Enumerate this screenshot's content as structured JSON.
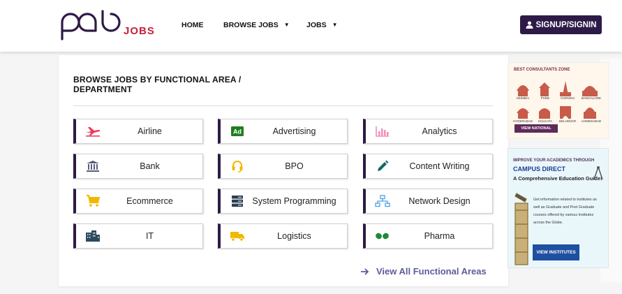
{
  "header": {
    "logo_main": "pab",
    "logo_sub": "JOBS",
    "nav": [
      {
        "label": "HOME",
        "dropdown": false
      },
      {
        "label": "BROWSE JOBS",
        "dropdown": true
      },
      {
        "label": "JOBS",
        "dropdown": true
      }
    ],
    "signup_label": "SIGNUP/SIGNIN"
  },
  "main": {
    "title": "BROWSE JOBS BY FUNCTIONAL AREA / DEPARTMENT",
    "areas": [
      {
        "label": "Airline",
        "icon": "plane-icon",
        "color": "#e83e5a"
      },
      {
        "label": "Advertising",
        "icon": "ad-icon",
        "color": "#1e7e1e"
      },
      {
        "label": "Analytics",
        "icon": "bar-chart-icon",
        "color": "#f08cb8"
      },
      {
        "label": "Bank",
        "icon": "bank-icon",
        "color": "#555f7a"
      },
      {
        "label": "BPO",
        "icon": "headset-icon",
        "color": "#f2b800"
      },
      {
        "label": "Content Writing",
        "icon": "pencil-icon",
        "color": "#0f6b62"
      },
      {
        "label": "Ecommerce",
        "icon": "cart-icon",
        "color": "#f2b800"
      },
      {
        "label": "System Programming",
        "icon": "server-icon",
        "color": "#2c3e50"
      },
      {
        "label": "Network Design",
        "icon": "network-icon",
        "color": "#4aa0e6"
      },
      {
        "label": "IT",
        "icon": "building-icon",
        "color": "#2c4a5e"
      },
      {
        "label": "Logistics",
        "icon": "truck-icon",
        "color": "#f2b800"
      },
      {
        "label": "Pharma",
        "icon": "pills-icon",
        "color": "#1e8a3a"
      }
    ],
    "view_all_label": "View All Functional Areas"
  },
  "ads": {
    "consultants": {
      "title": "BEST CONSULTANTS ZONE",
      "cities": [
        "MUMBAI",
        "PUNE",
        "CHENNAI",
        "BANGALORE",
        "HYDERABAD",
        "KOLKATA",
        "DELHI/NCR",
        "AHMEDABAD"
      ],
      "button": "VIEW NATIONAL"
    },
    "campus": {
      "line1": "IMPROVE YOUR ACADEMICS THROUGH",
      "line2": "CAMPUS DIRECT",
      "line3": "A Comprehensive Education Guide!",
      "body": "Get information related to institutes as well as Graduate and Post Graduate courses offered by various Institutes across the Globe.",
      "button": "VIEW INSTITUTES"
    }
  },
  "colors": {
    "brand": "#2e1a47",
    "accent": "#c8203a",
    "link": "#5c5c9e"
  }
}
